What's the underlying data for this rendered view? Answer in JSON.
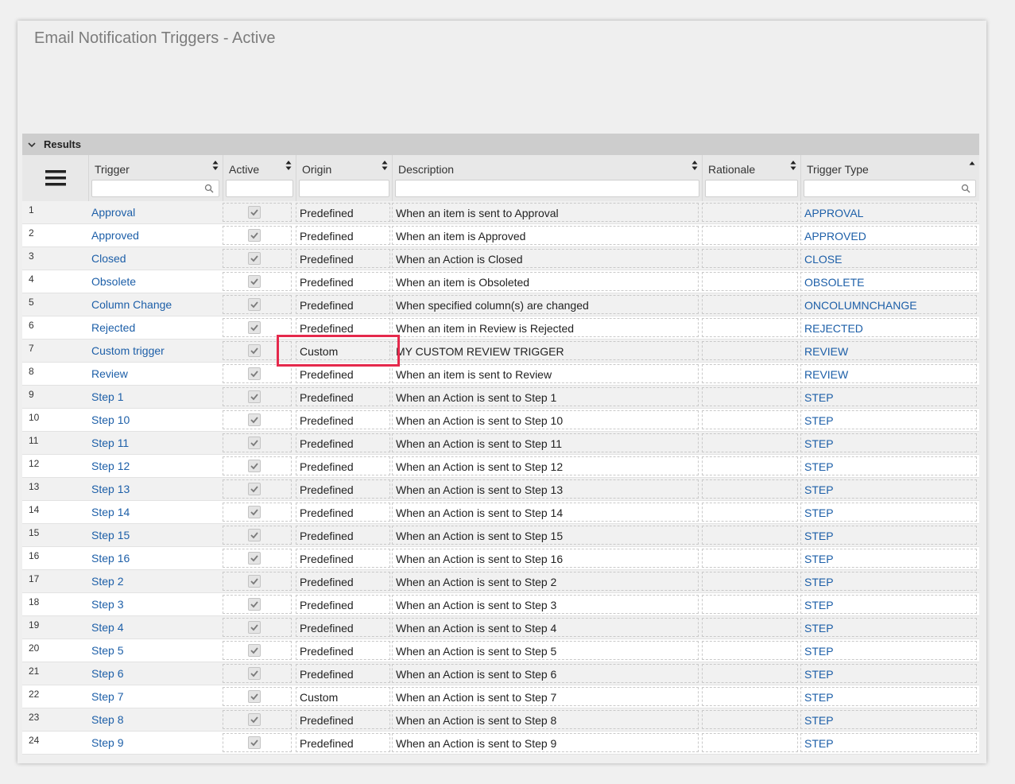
{
  "page": {
    "title": "Email Notification Triggers - Active"
  },
  "results": {
    "label": "Results"
  },
  "columns": {
    "trigger": "Trigger",
    "active": "Active",
    "origin": "Origin",
    "description": "Description",
    "rationale": "Rationale",
    "trigger_type": "Trigger Type"
  },
  "colors": {
    "link": "#1d5fa8",
    "highlight": "#e5294c"
  },
  "icons": {
    "menu": "hamburger-menu-icon",
    "sort": "sort-arrows-icon",
    "search": "search-icon",
    "collapse": "chevron-down-icon",
    "check": "checkmark-icon"
  },
  "rows": [
    {
      "num": "1",
      "trigger": "Approval",
      "active": true,
      "origin": "Predefined",
      "description": "When an item is sent to Approval",
      "rationale": "",
      "trigger_type": "APPROVAL"
    },
    {
      "num": "2",
      "trigger": "Approved",
      "active": true,
      "origin": "Predefined",
      "description": "When an item is Approved",
      "rationale": "",
      "trigger_type": "APPROVED"
    },
    {
      "num": "3",
      "trigger": "Closed",
      "active": true,
      "origin": "Predefined",
      "description": "When an Action is Closed",
      "rationale": "",
      "trigger_type": "CLOSE"
    },
    {
      "num": "4",
      "trigger": "Obsolete",
      "active": true,
      "origin": "Predefined",
      "description": "When an item is Obsoleted",
      "rationale": "",
      "trigger_type": "OBSOLETE"
    },
    {
      "num": "5",
      "trigger": "Column Change",
      "active": true,
      "origin": "Predefined",
      "description": "When specified column(s) are changed",
      "rationale": "",
      "trigger_type": "ONCOLUMNCHANGE"
    },
    {
      "num": "6",
      "trigger": "Rejected",
      "active": true,
      "origin": "Predefined",
      "description": "When an item in Review is Rejected",
      "rationale": "",
      "trigger_type": "REJECTED"
    },
    {
      "num": "7",
      "trigger": "Custom trigger",
      "active": true,
      "origin": "Custom",
      "description": "MY CUSTOM REVIEW TRIGGER",
      "rationale": "",
      "trigger_type": "REVIEW"
    },
    {
      "num": "8",
      "trigger": "Review",
      "active": true,
      "origin": "Predefined",
      "description": "When an item is sent to Review",
      "rationale": "",
      "trigger_type": "REVIEW"
    },
    {
      "num": "9",
      "trigger": "Step 1",
      "active": true,
      "origin": "Predefined",
      "description": "When an Action is sent to Step 1",
      "rationale": "",
      "trigger_type": "STEP"
    },
    {
      "num": "10",
      "trigger": "Step 10",
      "active": true,
      "origin": "Predefined",
      "description": "When an Action is sent to Step 10",
      "rationale": "",
      "trigger_type": "STEP"
    },
    {
      "num": "11",
      "trigger": "Step 11",
      "active": true,
      "origin": "Predefined",
      "description": "When an Action is sent to Step 11",
      "rationale": "",
      "trigger_type": "STEP"
    },
    {
      "num": "12",
      "trigger": "Step 12",
      "active": true,
      "origin": "Predefined",
      "description": "When an Action is sent to Step 12",
      "rationale": "",
      "trigger_type": "STEP"
    },
    {
      "num": "13",
      "trigger": "Step 13",
      "active": true,
      "origin": "Predefined",
      "description": "When an Action is sent to Step 13",
      "rationale": "",
      "trigger_type": "STEP"
    },
    {
      "num": "14",
      "trigger": "Step 14",
      "active": true,
      "origin": "Predefined",
      "description": "When an Action is sent to Step 14",
      "rationale": "",
      "trigger_type": "STEP"
    },
    {
      "num": "15",
      "trigger": "Step 15",
      "active": true,
      "origin": "Predefined",
      "description": "When an Action is sent to Step 15",
      "rationale": "",
      "trigger_type": "STEP"
    },
    {
      "num": "16",
      "trigger": "Step 16",
      "active": true,
      "origin": "Predefined",
      "description": "When an Action is sent to Step 16",
      "rationale": "",
      "trigger_type": "STEP"
    },
    {
      "num": "17",
      "trigger": "Step 2",
      "active": true,
      "origin": "Predefined",
      "description": "When an Action is sent to Step 2",
      "rationale": "",
      "trigger_type": "STEP"
    },
    {
      "num": "18",
      "trigger": "Step 3",
      "active": true,
      "origin": "Predefined",
      "description": "When an Action is sent to Step 3",
      "rationale": "",
      "trigger_type": "STEP"
    },
    {
      "num": "19",
      "trigger": "Step 4",
      "active": true,
      "origin": "Predefined",
      "description": "When an Action is sent to Step 4",
      "rationale": "",
      "trigger_type": "STEP"
    },
    {
      "num": "20",
      "trigger": "Step 5",
      "active": true,
      "origin": "Predefined",
      "description": "When an Action is sent to Step 5",
      "rationale": "",
      "trigger_type": "STEP"
    },
    {
      "num": "21",
      "trigger": "Step 6",
      "active": true,
      "origin": "Predefined",
      "description": "When an Action is sent to Step 6",
      "rationale": "",
      "trigger_type": "STEP"
    },
    {
      "num": "22",
      "trigger": "Step 7",
      "active": true,
      "origin": "Custom",
      "description": "When an Action is sent to Step 7",
      "rationale": "",
      "trigger_type": "STEP"
    },
    {
      "num": "23",
      "trigger": "Step 8",
      "active": true,
      "origin": "Predefined",
      "description": "When an Action is sent to Step 8",
      "rationale": "",
      "trigger_type": "STEP"
    },
    {
      "num": "24",
      "trigger": "Step 9",
      "active": true,
      "origin": "Predefined",
      "description": "When an Action is sent to Step 9",
      "rationale": "",
      "trigger_type": "STEP"
    }
  ]
}
